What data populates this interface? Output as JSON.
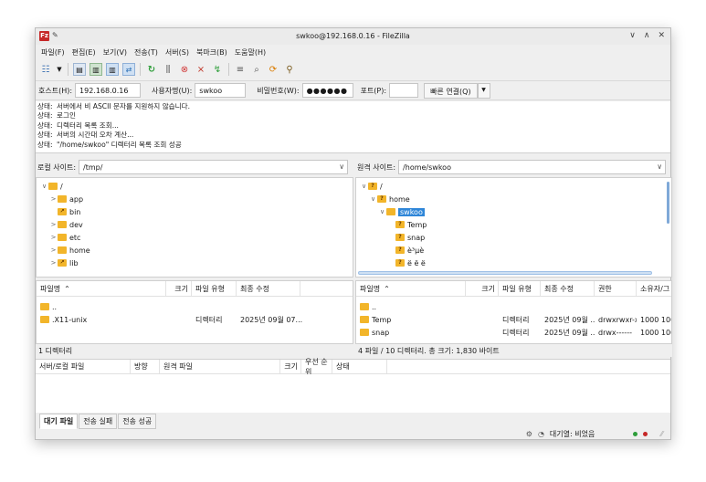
{
  "window": {
    "title": "swkoo@192.168.0.16 - FileZilla"
  },
  "menu": [
    "파일(F)",
    "편집(E)",
    "보기(V)",
    "전송(T)",
    "서버(S)",
    "북마크(B)",
    "도움말(H)"
  ],
  "quickconnect": {
    "host_label": "호스트(H):",
    "host_value": "192.168.0.16",
    "user_label": "사용자명(U):",
    "user_value": "swkoo",
    "pass_label": "비밀번호(W):",
    "pass_value": "●●●●●●",
    "port_label": "포트(P):",
    "port_value": "",
    "connect_label": "빠른 연결(Q)"
  },
  "log": [
    {
      "k": "상태:",
      "v": "서버에서 비 ASCII 문자를 지원하지 않습니다."
    },
    {
      "k": "상태:",
      "v": "로그인"
    },
    {
      "k": "상태:",
      "v": "디렉터리 목록 조회..."
    },
    {
      "k": "상태:",
      "v": "서버의 시간대 오차 계산..."
    },
    {
      "k": "상태:",
      "v": "\"/home/swkoo\" 디렉터리 목록 조회 성공"
    }
  ],
  "local": {
    "site_label": "로컬 사이트:",
    "path": "/tmp/",
    "tree": [
      {
        "label": "/",
        "chev": "∨"
      },
      {
        "label": "app",
        "chev": ">"
      },
      {
        "label": "bin",
        "chev": ""
      },
      {
        "label": "dev",
        "chev": ">"
      },
      {
        "label": "etc",
        "chev": ">"
      },
      {
        "label": "home",
        "chev": ">"
      },
      {
        "label": "lib",
        "chev": ">"
      }
    ],
    "headers": [
      "파일명",
      "크기",
      "파일 유형",
      "최종 수정"
    ],
    "rows": [
      {
        "name": "..",
        "size": "",
        "type": "",
        "modified": ""
      },
      {
        "name": ".X11-unix",
        "size": "",
        "type": "디렉터리",
        "modified": "2025년 09월 07..."
      }
    ],
    "status": "1 디렉터리"
  },
  "remote": {
    "site_label": "원격 사이트:",
    "path": "/home/swkoo",
    "tree": [
      {
        "label": "/",
        "chev": "∨"
      },
      {
        "label": "home",
        "chev": "∨"
      },
      {
        "label": "swkoo",
        "chev": "∨"
      },
      {
        "label": "Temp",
        "chev": ""
      },
      {
        "label": "snap",
        "chev": ""
      },
      {
        "label": "è³µè",
        "chev": ""
      },
      {
        "label": "ë ë ë",
        "chev": ""
      }
    ],
    "headers": [
      "파일명",
      "크기",
      "파일 유형",
      "최종 수정",
      "권한",
      "소유자/그"
    ],
    "rows": [
      {
        "name": "..",
        "size": "",
        "type": "",
        "modified": "",
        "perm": "",
        "owner": ""
      },
      {
        "name": "Temp",
        "size": "",
        "type": "디렉터리",
        "modified": "2025년 09월 ...",
        "perm": "drwxrwxr-x",
        "owner": "1000 1000"
      },
      {
        "name": "snap",
        "size": "",
        "type": "디렉터리",
        "modified": "2025년 09월 ...",
        "perm": "drwx------",
        "owner": "1000 1000"
      }
    ],
    "status": "4 파일 / 10 디렉터리. 총 크기: 1,830 바이트"
  },
  "queue": {
    "headers": [
      "서버/로컬 파일",
      "방향",
      "원격 파일",
      "크기",
      "우선 순위",
      "상태"
    ],
    "tabs": [
      "대기 파일",
      "전송 실패",
      "전송 성공"
    ]
  },
  "statusbar": {
    "queue_text": "대기열: 비었음"
  },
  "colors": {
    "accent": "#2f86d8",
    "folder": "#f2b52a",
    "led_green": "#2e9e3a",
    "led_red": "#c62828"
  }
}
